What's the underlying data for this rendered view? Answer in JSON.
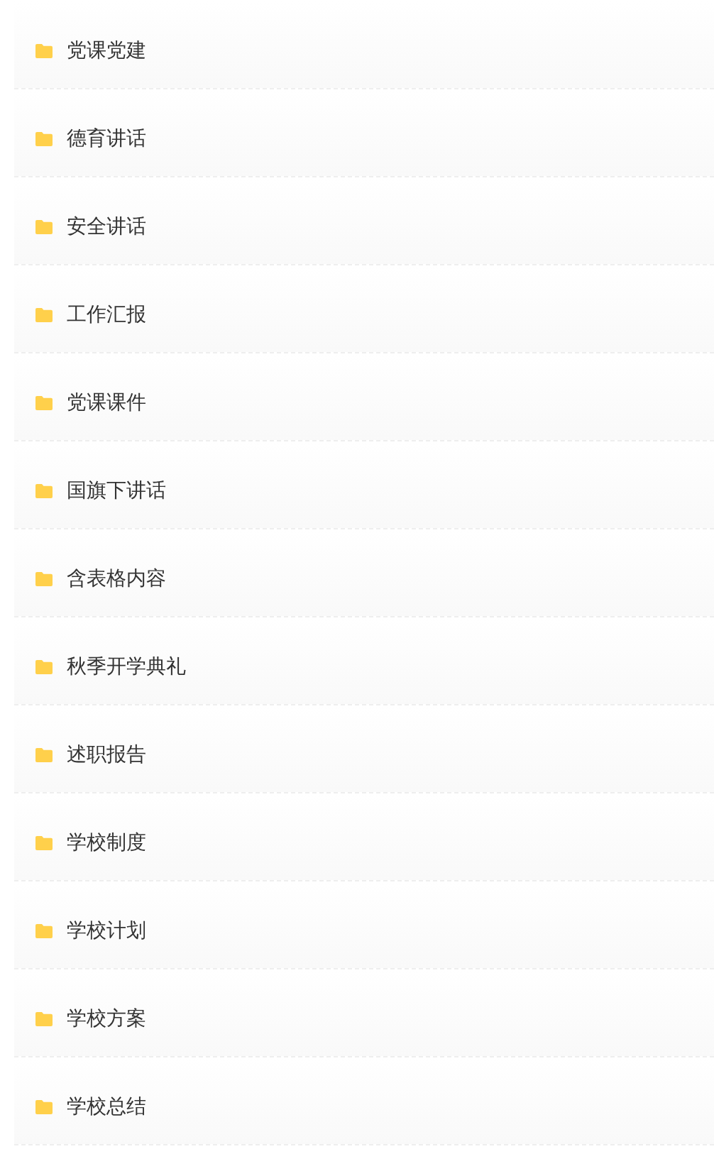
{
  "folders": [
    {
      "label": "党课党建"
    },
    {
      "label": "德育讲话"
    },
    {
      "label": "安全讲话"
    },
    {
      "label": "工作汇报"
    },
    {
      "label": "党课课件"
    },
    {
      "label": "国旗下讲话"
    },
    {
      "label": "含表格内容"
    },
    {
      "label": "秋季开学典礼"
    },
    {
      "label": "述职报告"
    },
    {
      "label": "学校制度"
    },
    {
      "label": "学校计划"
    },
    {
      "label": "学校方案"
    },
    {
      "label": "学校总结"
    }
  ]
}
